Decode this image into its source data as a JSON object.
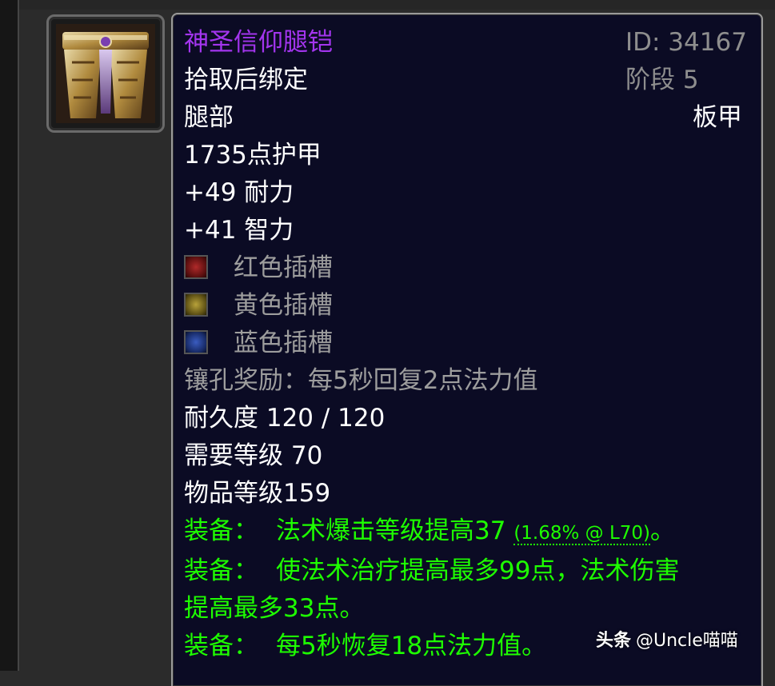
{
  "item": {
    "name": "神圣信仰腿铠",
    "id_label": "ID: 34167",
    "tier_label": "阶段 5",
    "bind": "拾取后绑定",
    "slot": "腿部",
    "armor_type": "板甲",
    "armor": "1735点护甲",
    "stats": [
      "+49 耐力",
      "+41 智力"
    ],
    "sockets": [
      {
        "color": "red",
        "label": "红色插槽"
      },
      {
        "color": "yellow",
        "label": "黄色插槽"
      },
      {
        "color": "blue",
        "label": "蓝色插槽"
      }
    ],
    "socket_bonus": "镶孔奖励：每5秒回复2点法力值",
    "durability": "耐久度 120 / 120",
    "required_level": "需要等级 70",
    "item_level": "物品等级159",
    "equip_effects": [
      {
        "prefix": "装备：",
        "text": "法术爆击等级提高37",
        "note": "(1.68% @ L70)",
        "suffix": "。"
      },
      {
        "prefix": "装备：",
        "text": "使法术治疗提高最多99点，法术伤害",
        "text2": "提高最多33点。"
      },
      {
        "prefix": "装备：",
        "text": "每5秒恢复18点法力值。"
      }
    ]
  },
  "colors": {
    "epic": "#a335ee",
    "equip": "#1eff00",
    "gray": "#9d9d9d",
    "white": "#ffffff",
    "tooltip_bg": "#0b0b24"
  },
  "watermark": {
    "brand": "头条",
    "handle": "@Uncle喵喵"
  },
  "icons": {
    "item_icon": "plate-legs-icon",
    "socket_icons": [
      "red-socket-icon",
      "yellow-socket-icon",
      "blue-socket-icon"
    ]
  }
}
